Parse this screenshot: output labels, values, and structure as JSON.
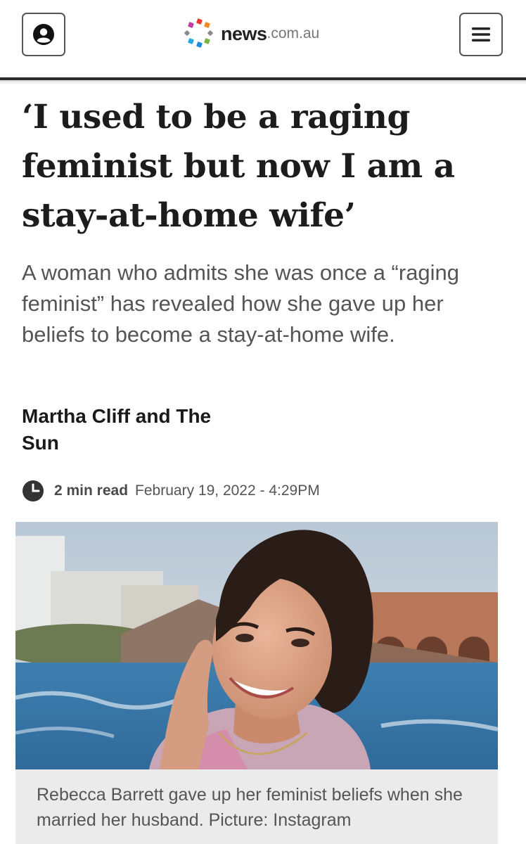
{
  "header": {
    "account_icon": "account-circle-icon",
    "menu_icon": "hamburger-menu-icon",
    "logo": {
      "name": "news",
      "domain": ".com.au"
    },
    "colors": {
      "rule": "#2a2a2a"
    }
  },
  "article": {
    "headline": "‘I used to be a raging feminist but now I am a stay-at-home wife’",
    "standfirst": "A woman who admits she was once a “raging feminist” has revealed how she gave up her beliefs to become a stay-at-home wife.",
    "byline_line1": "Martha Cliff and The",
    "byline_line2": "Sun",
    "read_icon": "clock-icon",
    "read_time": "2 min read",
    "date": "February 19, 2022 - 4:29PM",
    "image_caption": "Rebecca Barrett gave up her feminist beliefs when she married her husband. Picture: Instagram"
  }
}
